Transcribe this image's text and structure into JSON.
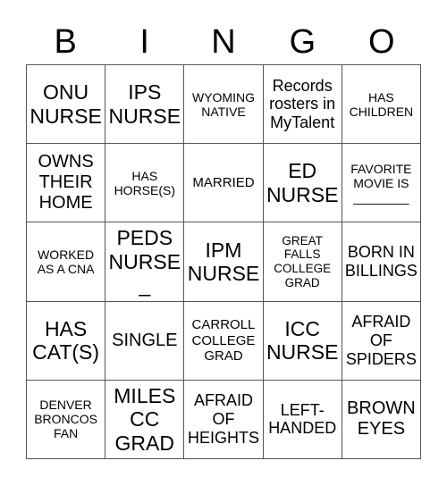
{
  "header": {
    "letters": [
      "B",
      "I",
      "N",
      "G",
      "O"
    ]
  },
  "card": {
    "rows": [
      [
        "ONU\nNURSE",
        "IPS\nNURSE",
        "WYOMING\nNATIVE",
        "Records\nrosters in\nMyTalent",
        "HAS\nCHILDREN"
      ],
      [
        "OWNS\nTHEIR\nHOME",
        "HAS\nHORSE(S)",
        "MARRIED",
        "ED\nNURSE",
        "FAVORITE\nMOVIE IS\n________"
      ],
      [
        "WORKED\nAS A CNA",
        "PEDS\nNURSE\n_",
        "IPM\nNURSE",
        "GREAT\nFALLS\nCOLLEGE\nGRAD",
        "BORN IN\nBILLINGS"
      ],
      [
        "HAS\nCAT(S)",
        "SINGLE",
        "CARROLL\nCOLLEGE\nGRAD",
        "ICC\nNURSE",
        "AFRAID\nOF\nSPIDERS"
      ],
      [
        "DENVER\nBRONCOS\nFAN",
        "MILES\nCC\nGRAD",
        "AFRAID\nOF\nHEIGHTS",
        "LEFT-\nHANDED",
        "BROWN\nEYES"
      ]
    ]
  },
  "colors": {
    "grid_line": "#555555",
    "text": "#000000",
    "background": "#ffffff"
  }
}
